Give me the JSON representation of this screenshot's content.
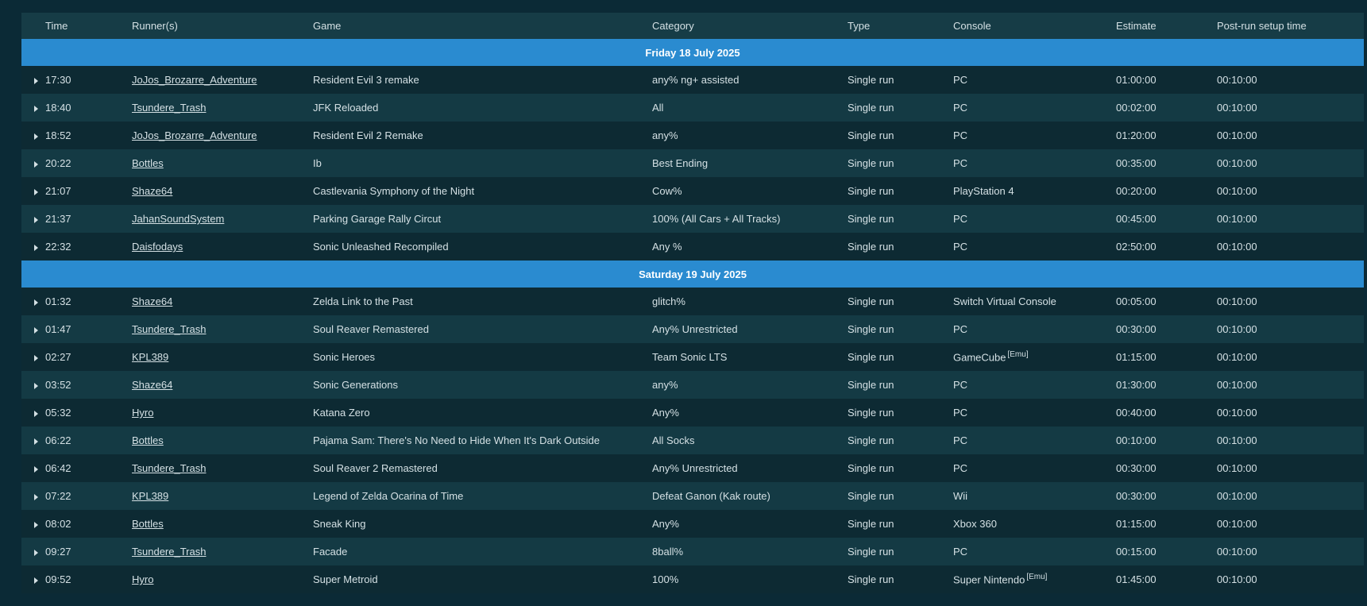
{
  "headers": {
    "time": "Time",
    "runners": "Runner(s)",
    "game": "Game",
    "category": "Category",
    "type": "Type",
    "console": "Console",
    "estimate": "Estimate",
    "setup": "Post-run setup time"
  },
  "days": [
    {
      "label": "Friday 18 July 2025",
      "runs": [
        {
          "time": "17:30",
          "runner": "JoJos_Brozarre_Adventure",
          "game": "Resident Evil 3 remake",
          "category": "any% ng+ assisted",
          "type": "Single run",
          "console": "PC",
          "emu": "",
          "estimate": "01:00:00",
          "setup": "00:10:00"
        },
        {
          "time": "18:40",
          "runner": "Tsundere_Trash",
          "game": "JFK Reloaded",
          "category": "All",
          "type": "Single run",
          "console": "PC",
          "emu": "",
          "estimate": "00:02:00",
          "setup": "00:10:00"
        },
        {
          "time": "18:52",
          "runner": "JoJos_Brozarre_Adventure",
          "game": "Resident Evil 2 Remake",
          "category": "any%",
          "type": "Single run",
          "console": "PC",
          "emu": "",
          "estimate": "01:20:00",
          "setup": "00:10:00"
        },
        {
          "time": "20:22",
          "runner": "Bottles",
          "game": "Ib",
          "category": "Best Ending",
          "type": "Single run",
          "console": "PC",
          "emu": "",
          "estimate": "00:35:00",
          "setup": "00:10:00"
        },
        {
          "time": "21:07",
          "runner": "Shaze64",
          "game": "Castlevania Symphony of the Night",
          "category": "Cow%",
          "type": "Single run",
          "console": "PlayStation 4",
          "emu": "",
          "estimate": "00:20:00",
          "setup": "00:10:00"
        },
        {
          "time": "21:37",
          "runner": "JahanSoundSystem",
          "game": "Parking Garage Rally Circut",
          "category": "100% (All Cars + All Tracks)",
          "type": "Single run",
          "console": "PC",
          "emu": "",
          "estimate": "00:45:00",
          "setup": "00:10:00"
        },
        {
          "time": "22:32",
          "runner": "Daisfodays",
          "game": "Sonic Unleashed Recompiled",
          "category": "Any %",
          "type": "Single run",
          "console": "PC",
          "emu": "",
          "estimate": "02:50:00",
          "setup": "00:10:00"
        }
      ]
    },
    {
      "label": "Saturday 19 July 2025",
      "runs": [
        {
          "time": "01:32",
          "runner": "Shaze64",
          "game": "Zelda Link to the Past",
          "category": "glitch%",
          "type": "Single run",
          "console": "Switch Virtual Console",
          "emu": "",
          "estimate": "00:05:00",
          "setup": "00:10:00"
        },
        {
          "time": "01:47",
          "runner": "Tsundere_Trash",
          "game": "Soul Reaver Remastered",
          "category": "Any% Unrestricted",
          "type": "Single run",
          "console": "PC",
          "emu": "",
          "estimate": "00:30:00",
          "setup": "00:10:00"
        },
        {
          "time": "02:27",
          "runner": "KPL389",
          "game": "Sonic Heroes",
          "category": "Team Sonic LTS",
          "type": "Single run",
          "console": "GameCube",
          "emu": "[Emu]",
          "estimate": "01:15:00",
          "setup": "00:10:00"
        },
        {
          "time": "03:52",
          "runner": "Shaze64",
          "game": "Sonic Generations",
          "category": "any%",
          "type": "Single run",
          "console": "PC",
          "emu": "",
          "estimate": "01:30:00",
          "setup": "00:10:00"
        },
        {
          "time": "05:32",
          "runner": "Hyro",
          "game": "Katana Zero",
          "category": "Any%",
          "type": "Single run",
          "console": "PC",
          "emu": "",
          "estimate": "00:40:00",
          "setup": "00:10:00"
        },
        {
          "time": "06:22",
          "runner": "Bottles",
          "game": "Pajama Sam: There's No Need to Hide When It's Dark Outside",
          "category": "All Socks",
          "type": "Single run",
          "console": "PC",
          "emu": "",
          "estimate": "00:10:00",
          "setup": "00:10:00"
        },
        {
          "time": "06:42",
          "runner": "Tsundere_Trash",
          "game": "Soul Reaver 2 Remastered",
          "category": "Any% Unrestricted",
          "type": "Single run",
          "console": "PC",
          "emu": "",
          "estimate": "00:30:00",
          "setup": "00:10:00"
        },
        {
          "time": "07:22",
          "runner": "KPL389",
          "game": "Legend of Zelda Ocarina of Time",
          "category": "Defeat Ganon (Kak route)",
          "type": "Single run",
          "console": "Wii",
          "emu": "",
          "estimate": "00:30:00",
          "setup": "00:10:00"
        },
        {
          "time": "08:02",
          "runner": "Bottles",
          "game": "Sneak King",
          "category": "Any%",
          "type": "Single run",
          "console": "Xbox 360",
          "emu": "",
          "estimate": "01:15:00",
          "setup": "00:10:00"
        },
        {
          "time": "09:27",
          "runner": "Tsundere_Trash",
          "game": "Facade",
          "category": "8ball%",
          "type": "Single run",
          "console": "PC",
          "emu": "",
          "estimate": "00:15:00",
          "setup": "00:10:00"
        },
        {
          "time": "09:52",
          "runner": "Hyro",
          "game": "Super Metroid",
          "category": "100%",
          "type": "Single run",
          "console": "Super Nintendo",
          "emu": "[Emu]",
          "estimate": "01:45:00",
          "setup": "00:10:00"
        }
      ]
    }
  ],
  "colors": {
    "background": "#0b2a36",
    "header_row": "#163c46",
    "day_row": "#2a8bd0",
    "row_odd": "#0d2a33",
    "row_even": "#143a44",
    "text": "#d4e0e4"
  },
  "icons": {
    "row_toggle": "caret-right-icon"
  }
}
